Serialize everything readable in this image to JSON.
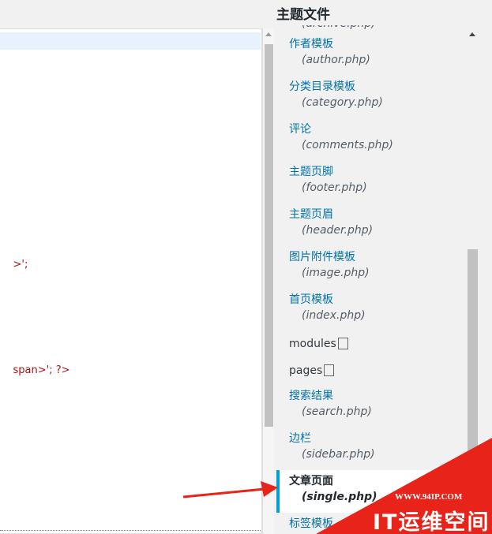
{
  "panel": {
    "title": "主题文件"
  },
  "editor": {
    "fragments": [
      ">';",
      "span>'; ?>"
    ]
  },
  "files": {
    "clipped_top": "(archive.php)",
    "items": [
      {
        "label": "作者模板",
        "file": "(author.php)"
      },
      {
        "label": "分类目录模板",
        "file": "(category.php)"
      },
      {
        "label": "评论",
        "file": "(comments.php)"
      },
      {
        "label": "主题页脚",
        "file": "(footer.php)"
      },
      {
        "label": "主题页眉",
        "file": "(header.php)"
      },
      {
        "label": "图片附件模板",
        "file": "(image.php)"
      },
      {
        "label": "首页模板",
        "file": "(index.php)"
      }
    ],
    "folders": [
      "modules",
      "pages"
    ],
    "items2": [
      {
        "label": "搜索结果",
        "file": "(search.php)"
      },
      {
        "label": "边栏",
        "file": "(sidebar.php)"
      }
    ],
    "active": {
      "label": "文章页面",
      "file": "(single.php)"
    },
    "clipped_bottom": "标签模板"
  },
  "watermark": {
    "url": "WWW.94IP.COM",
    "brand": "IT运维空间"
  },
  "colors": {
    "link": "#0073aa",
    "active_border": "#00a0d2",
    "arrow": "#e8231a",
    "watermark_bg": "#e8231a"
  }
}
